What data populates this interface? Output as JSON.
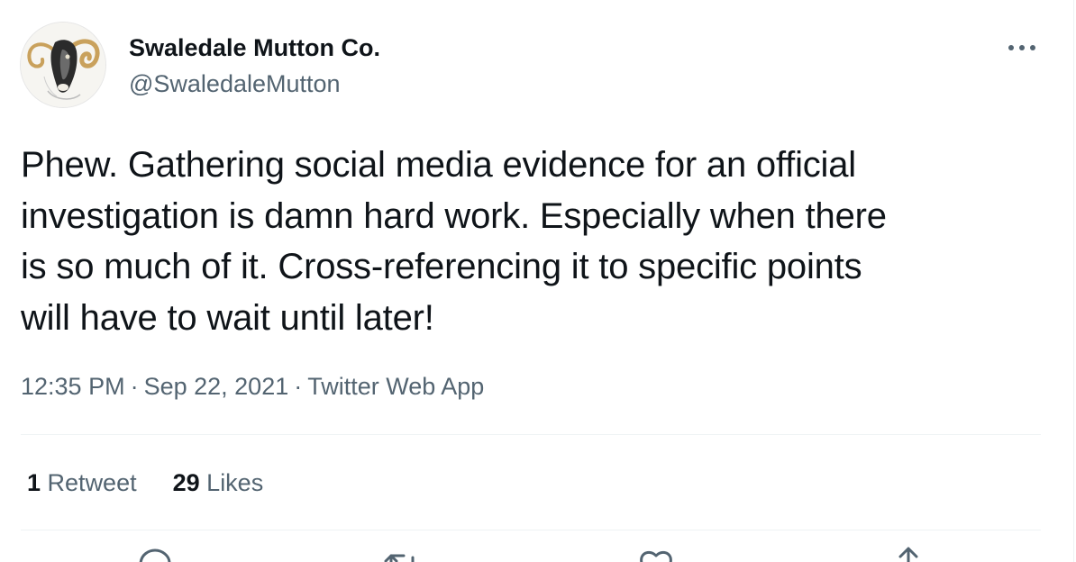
{
  "tweet": {
    "author": {
      "display_name": "Swaledale Mutton Co.",
      "handle": "@SwaledaleMutton",
      "avatar_icon": "ram-avatar"
    },
    "text": "Phew.  Gathering social media evidence for an official\ninvestigation is damn hard work.  Especially when there\nis so much of it.  Cross-referencing it to specific points\nwill have to wait until later!",
    "time": "12:35 PM",
    "date": "Sep 22, 2021",
    "separator": "·",
    "source": "Twitter Web App",
    "stats": {
      "retweets_count": "1",
      "retweets_label": "Retweet",
      "likes_count": "29",
      "likes_label": "Likes"
    },
    "actions": [
      "reply-icon",
      "retweet-icon",
      "like-icon",
      "share-icon"
    ]
  },
  "colors": {
    "text": "#0f1419",
    "secondary": "#536471",
    "divider": "#eff3f4"
  }
}
